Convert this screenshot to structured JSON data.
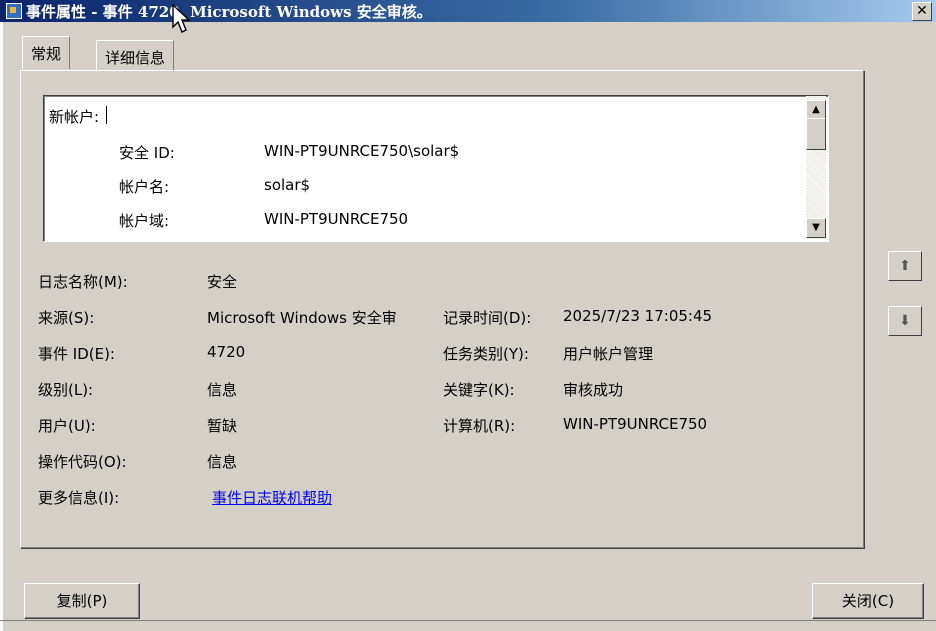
{
  "window": {
    "title": "事件属性 - 事件 4720, Microsoft Windows 安全审核。"
  },
  "tabs": [
    {
      "label": "常规"
    },
    {
      "label": "详细信息"
    }
  ],
  "description": {
    "heading": "新帐户:",
    "rows": [
      {
        "label": "安全 ID:",
        "value": "WIN-PT9UNRCE750\\solar$"
      },
      {
        "label": "帐户名:",
        "value": "solar$"
      },
      {
        "label": "帐户域:",
        "value": "WIN-PT9UNRCE750"
      }
    ]
  },
  "fields": {
    "log_name": {
      "label": "日志名称(M):",
      "value": "安全"
    },
    "source": {
      "label": "来源(S):",
      "value": "Microsoft Windows 安全审"
    },
    "logged": {
      "label": "记录时间(D):",
      "value": "2025/7/23 17:05:45"
    },
    "event_id": {
      "label": "事件 ID(E):",
      "value": "4720"
    },
    "task_category": {
      "label": "任务类别(Y):",
      "value": "用户帐户管理"
    },
    "level": {
      "label": "级别(L):",
      "value": "信息"
    },
    "keywords": {
      "label": "关键字(K):",
      "value": "审核成功"
    },
    "user": {
      "label": "用户(U):",
      "value": "暂缺"
    },
    "computer": {
      "label": "计算机(R):",
      "value": "WIN-PT9UNRCE750"
    },
    "opcode": {
      "label": "操作代码(O):",
      "value": "信息"
    },
    "more_info": {
      "label": "更多信息(I):",
      "link": "事件日志联机帮助"
    }
  },
  "buttons": {
    "copy": "复制(P)",
    "close": "关闭(C)"
  },
  "icons": {
    "close": "close-icon",
    "up": "arrow-up-icon",
    "down": "arrow-down-icon",
    "app": "event-viewer-icon",
    "cursor": "mouse-cursor-icon"
  }
}
